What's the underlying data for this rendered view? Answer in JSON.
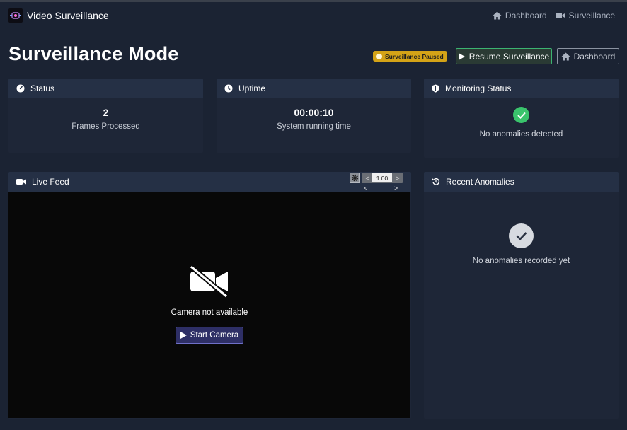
{
  "navbar": {
    "title": "Video Surveillance",
    "links": [
      {
        "label": "Dashboard",
        "icon": "home-icon"
      },
      {
        "label": "Surveillance",
        "icon": "video-camera-icon"
      }
    ]
  },
  "header": {
    "title": "Surveillance Mode",
    "badge": "Surveillance Paused",
    "resume_label": "Resume Surveillance",
    "dashboard_label": "Dashboard"
  },
  "status_card": {
    "title": "Status",
    "value": "2",
    "label": "Frames Processed",
    "icon": "gauge-icon"
  },
  "uptime_card": {
    "title": "Uptime",
    "value": "00:00:10",
    "label": "System running time",
    "icon": "clock-icon"
  },
  "monitoring_card": {
    "title": "Monitoring Status",
    "message": "No anomalies detected",
    "icon": "shield-icon"
  },
  "live_feed": {
    "title": "Live Feed",
    "icon": "video-camera-icon",
    "speed_value": "1.00",
    "prev_symbol": "<",
    "next_symbol": ">",
    "camera_message": "Camera not available",
    "start_label": "Start Camera"
  },
  "anomalies_card": {
    "title": "Recent Anomalies",
    "message": "No anomalies recorded yet",
    "icon": "history-icon"
  },
  "colors": {
    "background": "#1b2333",
    "card": "#1e2637",
    "card_header": "#253045",
    "badge": "#d4a317",
    "success": "#3ac46c",
    "primary_button": "#2e2f66"
  }
}
